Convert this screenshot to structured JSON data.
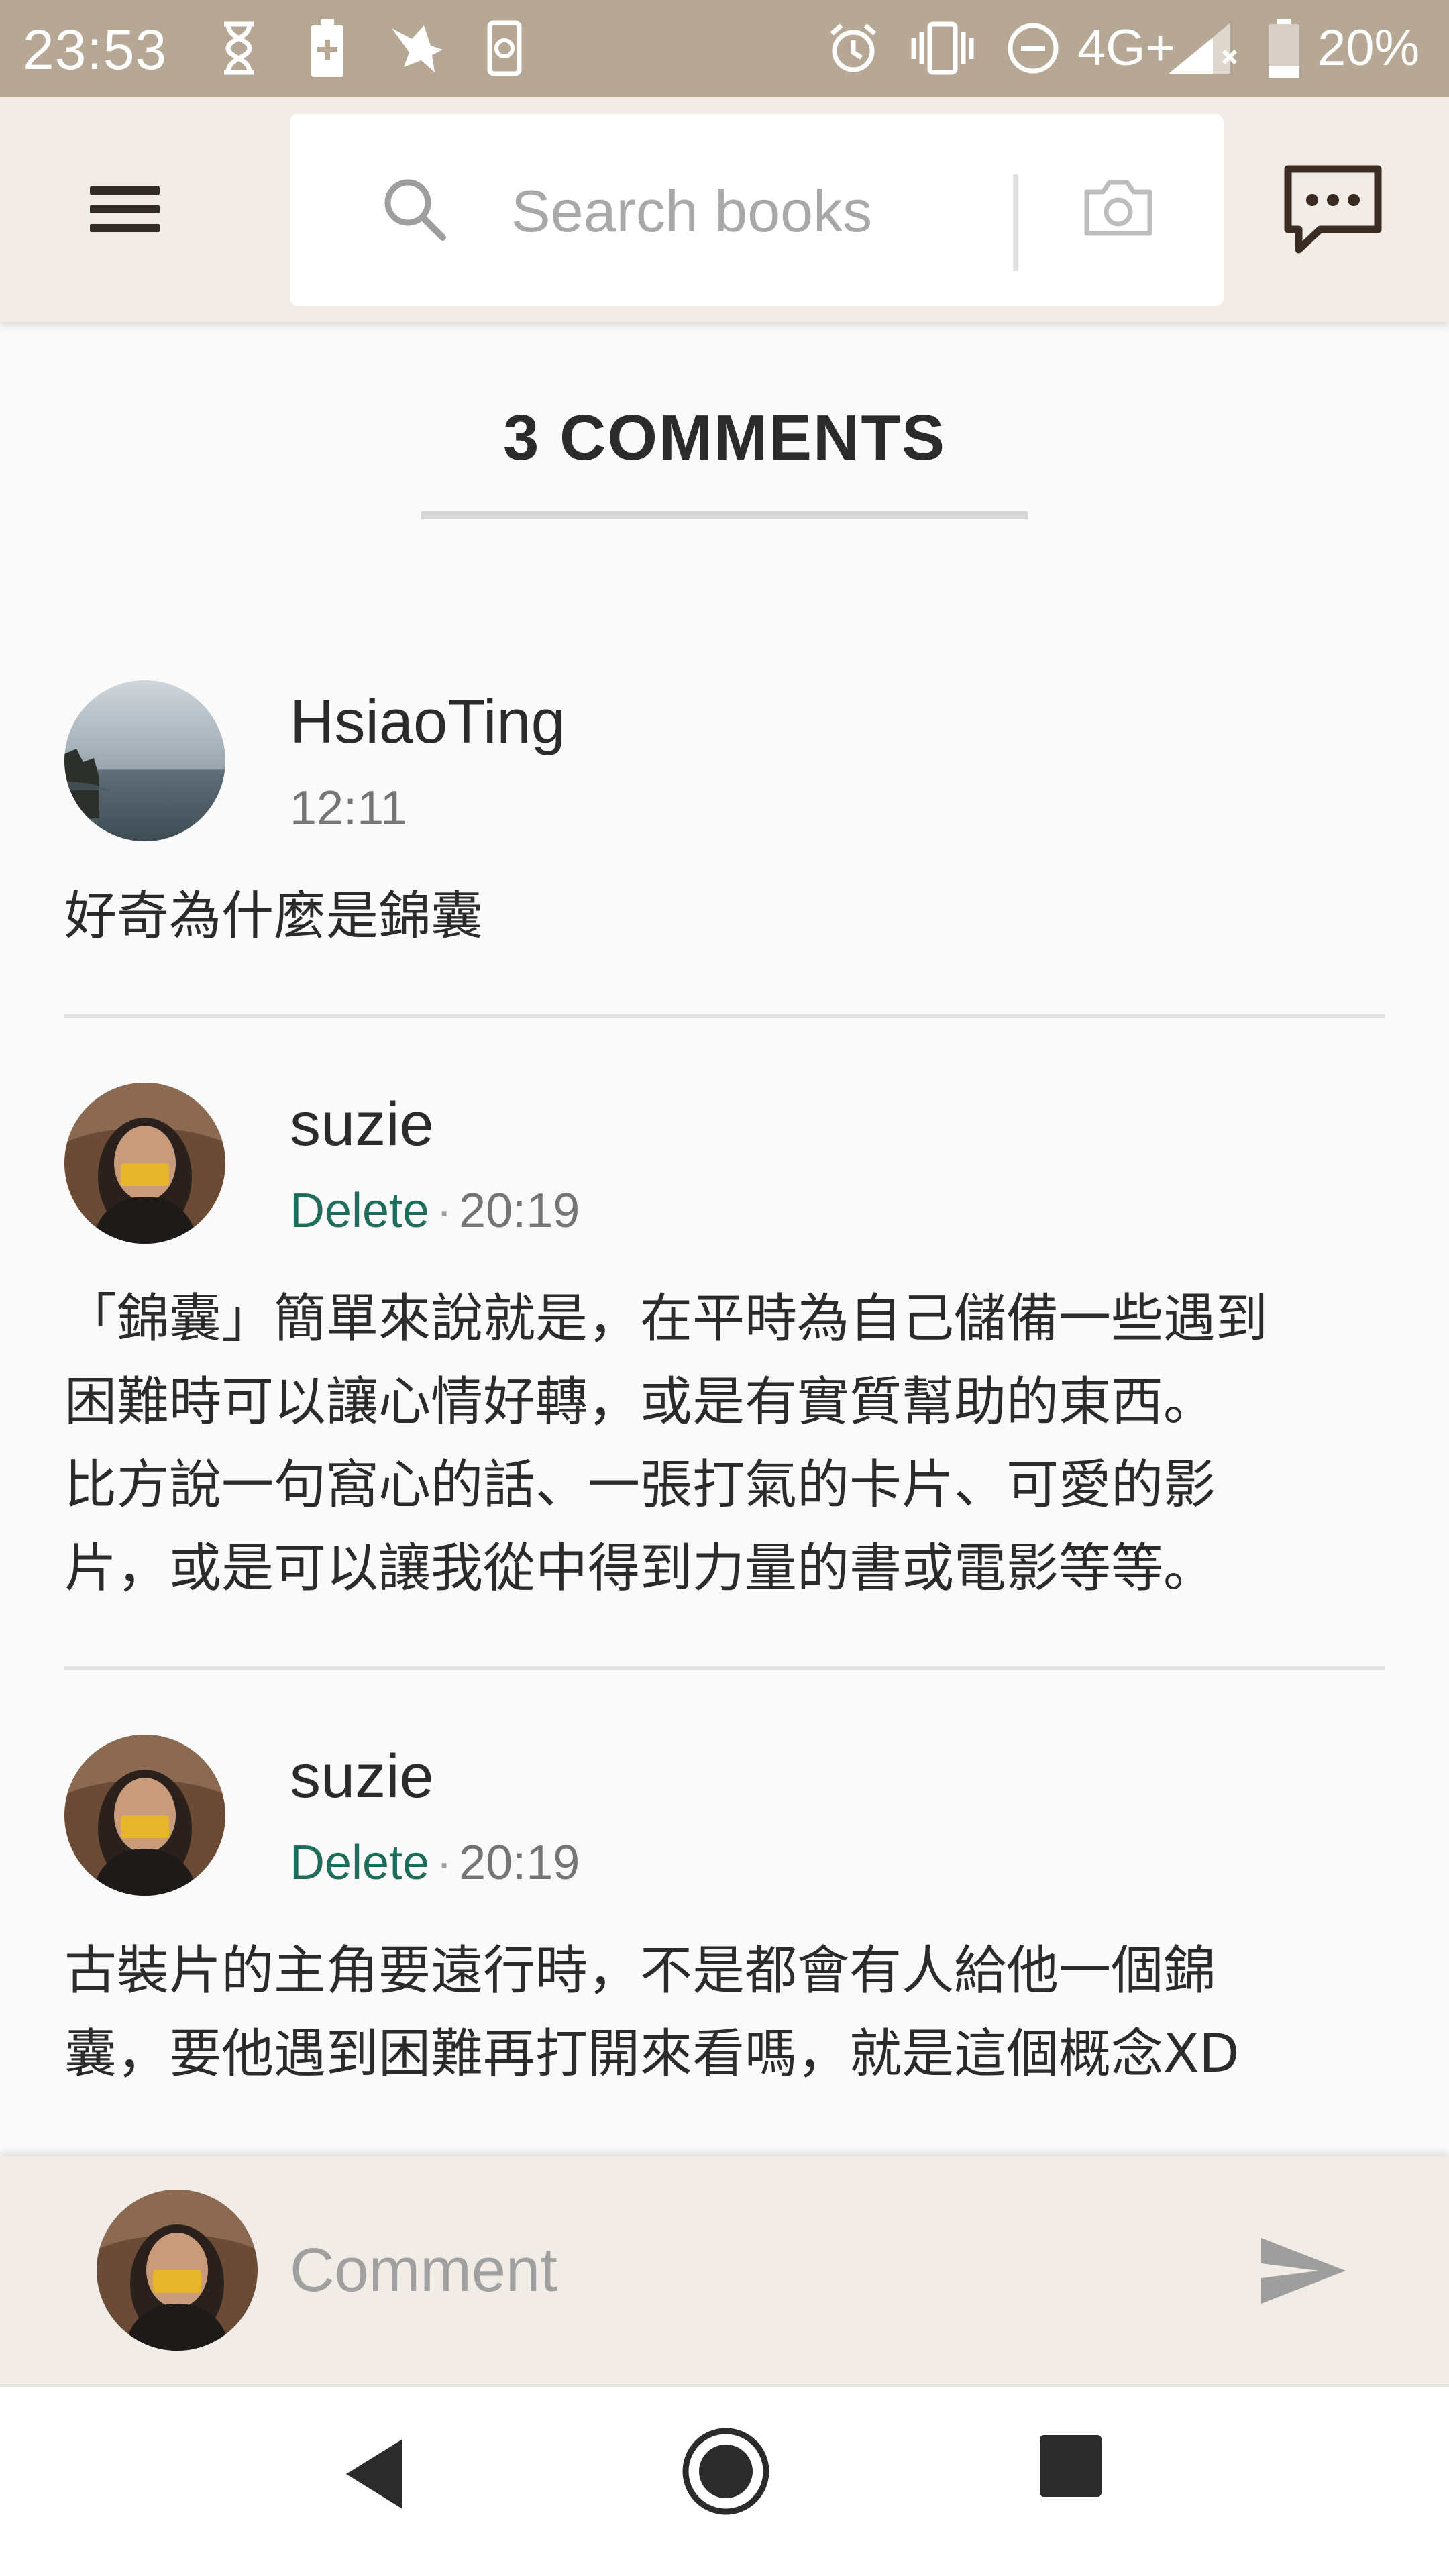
{
  "status_bar": {
    "time": "23:53",
    "network": "4G+",
    "battery": "20%",
    "icons": [
      "hourglass-icon",
      "battery-saver-icon",
      "app-bird-icon",
      "device-icon",
      "alarm-icon",
      "vibrate-icon",
      "do-not-disturb-icon",
      "signal-icon",
      "battery-icon"
    ]
  },
  "app_bar": {
    "search": {
      "placeholder": "Search books"
    },
    "icons": [
      "menu-icon",
      "search-icon",
      "camera-icon",
      "chat-icon"
    ]
  },
  "comments_section": {
    "title": "3 COMMENTS",
    "comments": [
      {
        "author": "HsiaoTing",
        "time": "12:11",
        "delete_label": "",
        "text": "好奇為什麼是錦囊"
      },
      {
        "author": "suzie",
        "time": "20:19",
        "delete_label": "Delete",
        "text_lines": [
          "「錦囊」簡單來說就是，在平時為自己儲備一些遇到",
          "困難時可以讓心情好轉，或是有實質幫助的東西。",
          "比方說一句窩心的話、一張打氣的卡片、可愛的影",
          "片，或是可以讓我從中得到力量的書或電影等等。"
        ]
      },
      {
        "author": "suzie",
        "time": "20:19",
        "delete_label": "Delete",
        "text_lines": [
          "古裝片的主角要遠行時，不是都會有人給他一個錦",
          "囊，要他遇到困難再打開來看嗎，就是這個概念XD"
        ]
      }
    ],
    "meta_separator": "·"
  },
  "composer": {
    "placeholder": "Comment"
  },
  "colors": {
    "status_bar": "#b7a896",
    "app_bar": "#f1ede6",
    "delete_link": "#1f6e5c"
  }
}
